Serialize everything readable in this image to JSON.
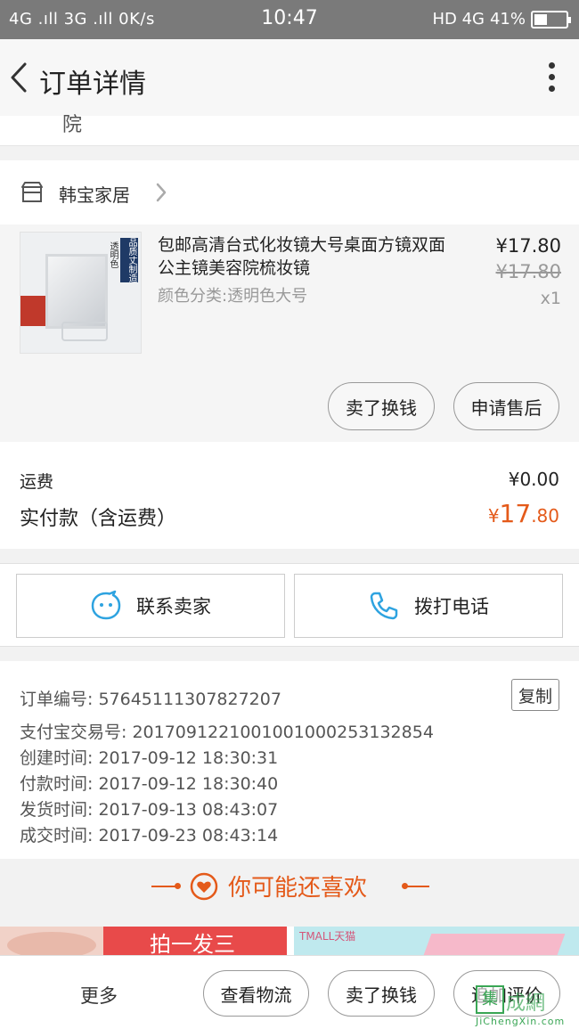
{
  "status_bar": {
    "left": "4G .ıll 3G .ıll 0K/s",
    "time": "10:47",
    "right": "HD 4G",
    "battery": "41%",
    "battery_level": 0.41
  },
  "nav": {
    "title": "订单详情"
  },
  "address_tail": "院",
  "shop": {
    "name": "韩宝家居"
  },
  "product": {
    "title": "包邮高清台式化妆镜大号桌面方镜双面公主镜美容院梳妆镜",
    "spec": "颜色分类:透明色大号",
    "price": "¥17.80",
    "original_price": "¥17.80",
    "quantity": "x1",
    "thumb_label_1": "透明色",
    "thumb_label_2": "品质丈制造"
  },
  "item_actions": {
    "sell": "卖了换钱",
    "after_sale": "申请售后"
  },
  "fees": {
    "shipping_label": "运费",
    "shipping_value": "¥0.00",
    "paid_label": "实付款（含运费）",
    "paid_currency": "¥",
    "paid_int": "17",
    "paid_dec": ".80"
  },
  "contact": {
    "seller": "联系卖家",
    "phone": "拨打电话"
  },
  "order_info": {
    "order_no": "订单编号: 57645111307827207",
    "copy": "复制",
    "alipay_no": "支付宝交易号: 2017091221001001000253132854",
    "created": "创建时间: 2017-09-12 18:30:31",
    "paid": "付款时间: 2017-09-12 18:30:40",
    "shipped": "发货时间: 2017-09-13 08:43:07",
    "completed": "成交时间: 2017-09-23 08:43:14"
  },
  "recommend": {
    "title": "你可能还喜欢",
    "banner1": "拍一发三",
    "banner2": "TMALL天猫"
  },
  "bottom_bar": {
    "more": "更多",
    "logistics": "查看物流",
    "sell": "卖了换钱",
    "review": "追加评价"
  },
  "watermark": {
    "box": "集",
    "name": "成網",
    "url": "JiChengXin.com"
  },
  "colors": {
    "accent": "#e45a1a",
    "status_bar": "#7a7a7a"
  }
}
